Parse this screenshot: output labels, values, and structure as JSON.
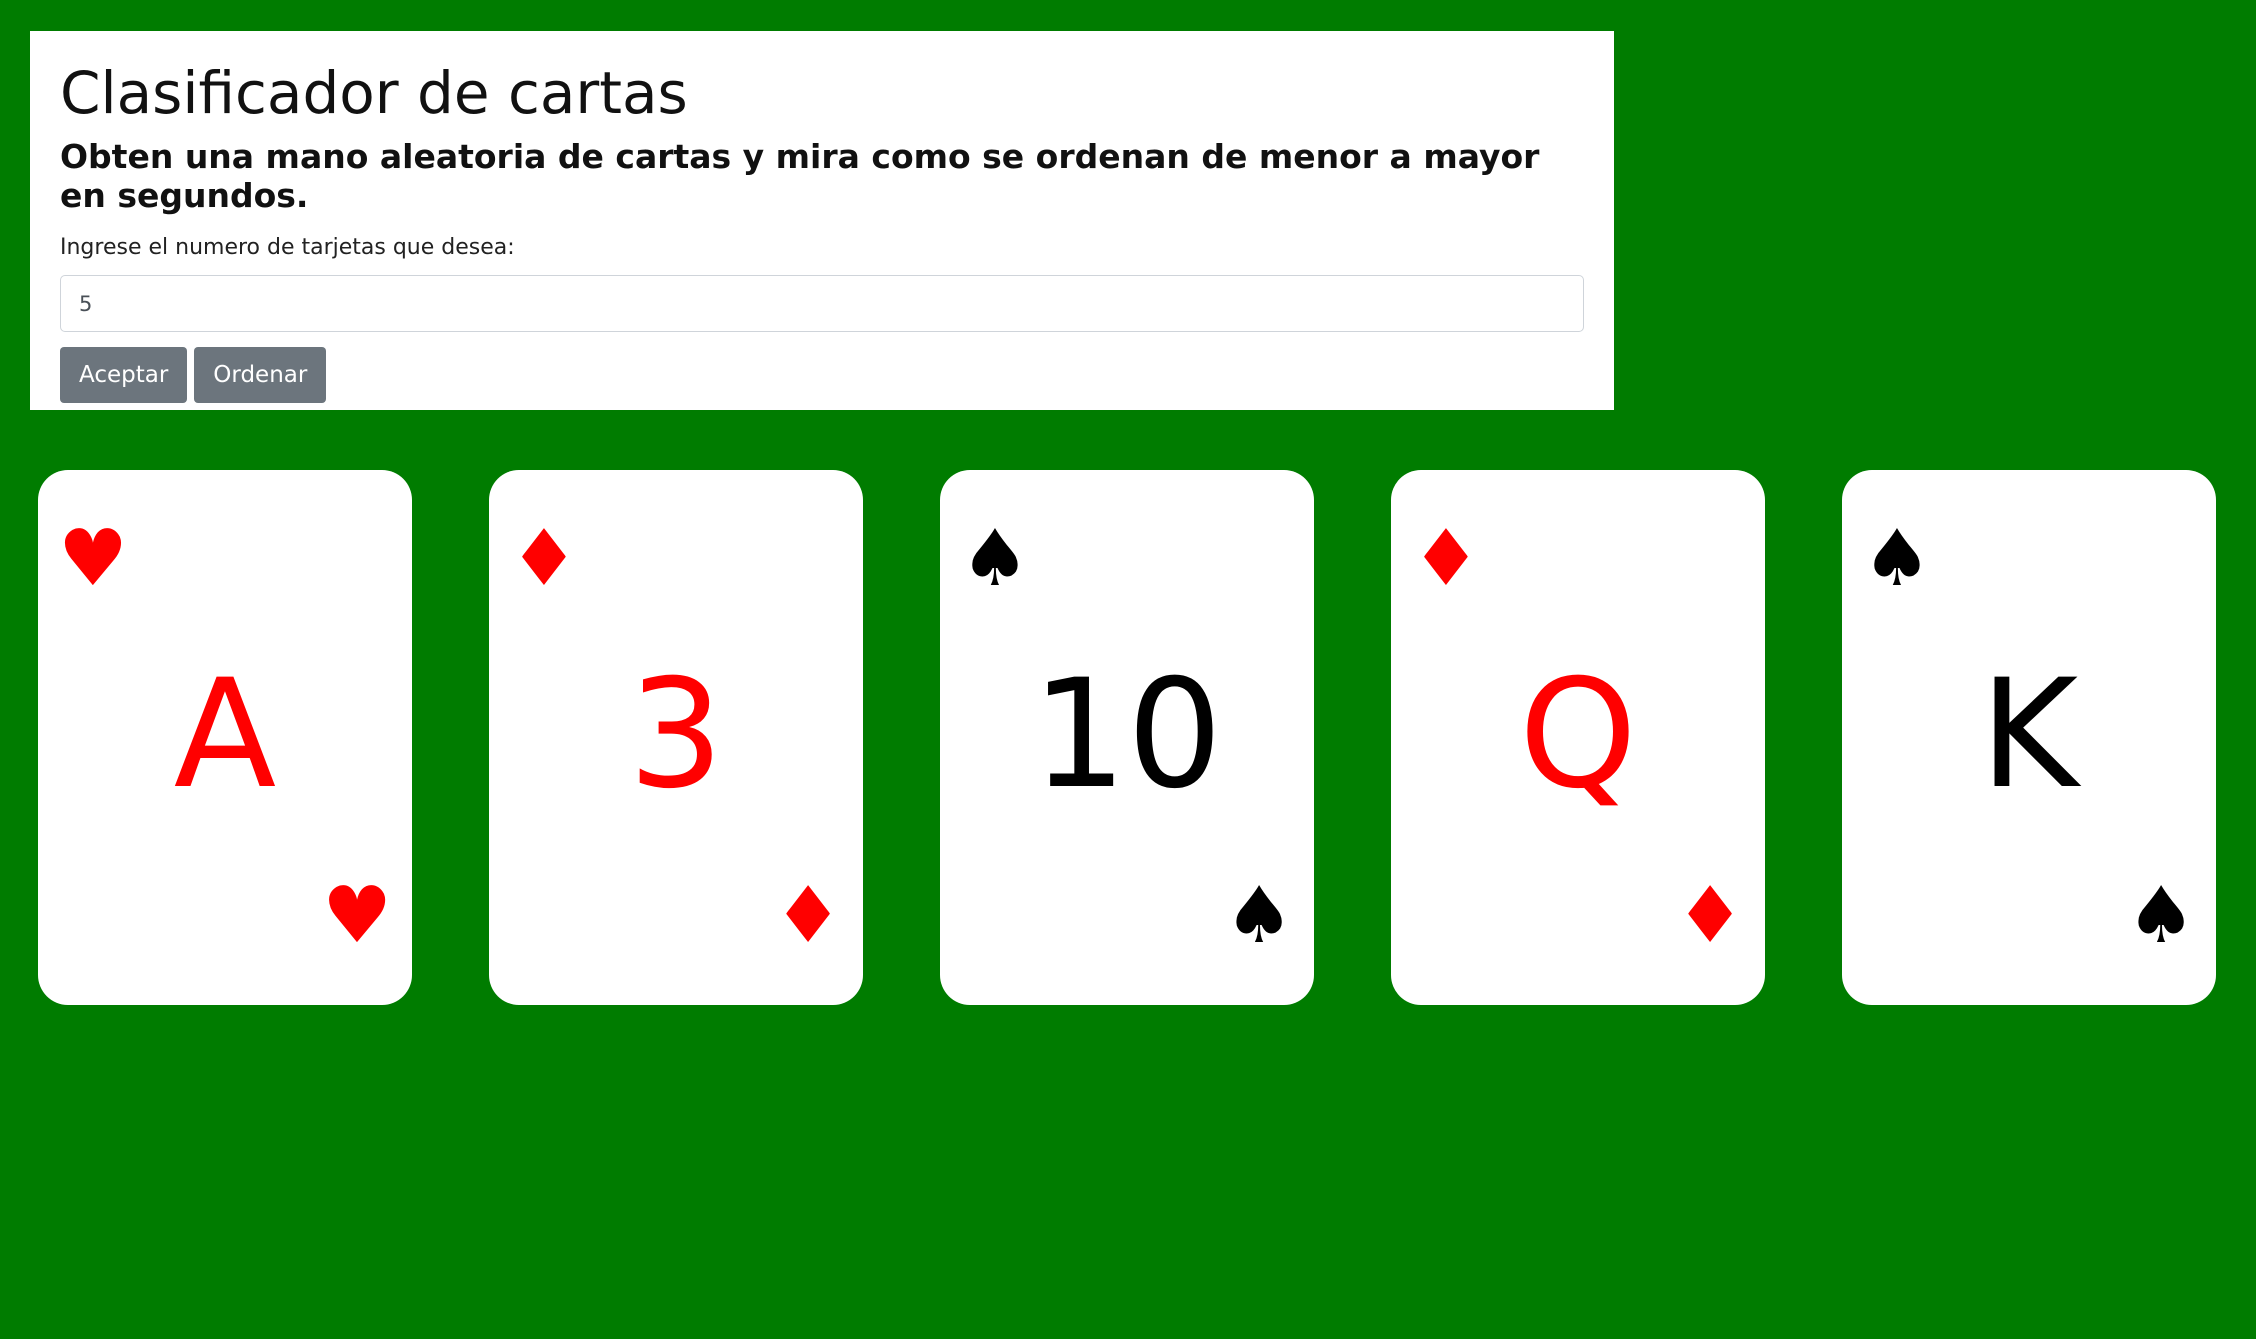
{
  "header": {
    "title": "Clasificador de cartas",
    "subtitle": "Obten una mano aleatoria de cartas y mira como se ordenan de menor a mayor en segundos."
  },
  "form": {
    "label": "Ingrese el numero de tarjetas que desea:",
    "input_value": "5",
    "accept_label": "Aceptar",
    "sort_label": "Ordenar"
  },
  "colors": {
    "background": "#007c00",
    "red_suit": "#ff0000",
    "black_suit": "#000000",
    "button": "#6c757d"
  },
  "cards": [
    {
      "rank": "A",
      "suit": "♥",
      "suit_name": "heart",
      "color": "red"
    },
    {
      "rank": "3",
      "suit": "♦",
      "suit_name": "diamond",
      "color": "red"
    },
    {
      "rank": "10",
      "suit": "♠",
      "suit_name": "spade",
      "color": "black"
    },
    {
      "rank": "Q",
      "suit": "♦",
      "suit_name": "diamond",
      "color": "red"
    },
    {
      "rank": "K",
      "suit": "♠",
      "suit_name": "spade",
      "color": "black"
    }
  ]
}
